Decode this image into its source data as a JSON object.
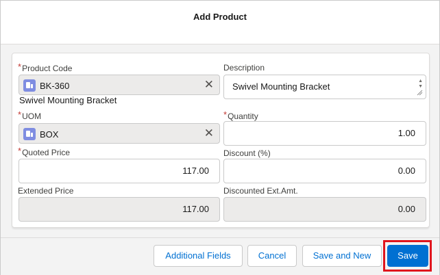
{
  "modal": {
    "title": "Add Product"
  },
  "fields": {
    "product_code": {
      "label": "Product Code",
      "value": "BK-360",
      "subtext": "Swivel Mounting Bracket",
      "required": "*"
    },
    "description": {
      "label": "Description",
      "value": "Swivel Mounting Bracket"
    },
    "uom": {
      "label": "UOM",
      "value": "BOX",
      "required": "*"
    },
    "quantity": {
      "label": "Quantity",
      "value": "1.00",
      "required": "*"
    },
    "quoted_price": {
      "label": "Quoted Price",
      "value": "117.00",
      "required": "*"
    },
    "discount": {
      "label": "Discount (%)",
      "value": "0.00"
    },
    "extended_price": {
      "label": "Extended Price",
      "value": "117.00"
    },
    "discounted_ext_amt": {
      "label": "Discounted Ext.Amt.",
      "value": "0.00"
    }
  },
  "footer": {
    "additional_fields": "Additional Fields",
    "cancel": "Cancel",
    "save_and_new": "Save and New",
    "save": "Save"
  },
  "icons": {
    "lookup": "product-record-icon",
    "clear": "clear-icon"
  },
  "colors": {
    "brand": "#0070d2",
    "required": "#c23934",
    "highlight": "#e0151d",
    "lookup_icon": "#7f8de1"
  }
}
